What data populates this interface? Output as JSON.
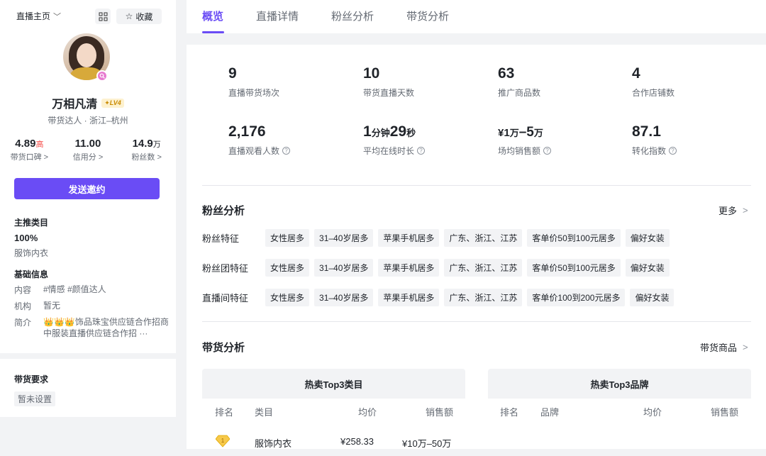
{
  "sidebar": {
    "home_label": "直播主页",
    "favorite_label": "收藏",
    "name": "万相凡清",
    "level": "LV4",
    "subtitle": "带货达人 · 浙江–杭州",
    "stats": [
      {
        "value": "4.89",
        "suffix": "高",
        "label": "带货口碑 >"
      },
      {
        "value": "11.00",
        "suffix": "",
        "label": "信用分 >"
      },
      {
        "value": "14.9",
        "suffix": "万",
        "label": "粉丝数 >"
      }
    ],
    "invite_label": "发送邀约",
    "main_category_title": "主推类目",
    "main_category_pct": "100%",
    "main_category_name": "服饰内衣",
    "basic_info_title": "基础信息",
    "info": [
      {
        "key": "内容",
        "value": "#情感  #颜值达人"
      },
      {
        "key": "机构",
        "value": "暂无"
      },
      {
        "key": "简介",
        "value_line1": "饰品珠宝供应链合作招商",
        "value_line2": "中服装直播供应链合作招 ···",
        "crowns": "👑👑👑"
      }
    ],
    "requirements_title": "带货要求",
    "requirements_value": "暂未设置"
  },
  "tabs": [
    "概览",
    "直播详情",
    "粉丝分析",
    "带货分析"
  ],
  "metrics": [
    {
      "num": "9",
      "label": "直播带货场次",
      "help": false
    },
    {
      "num": "10",
      "label": "带货直播天数",
      "help": false
    },
    {
      "num": "63",
      "label": "推广商品数",
      "help": false
    },
    {
      "num": "4",
      "label": "合作店铺数",
      "help": false
    },
    {
      "num": "2,176",
      "label": "直播观看人数",
      "help": true
    },
    {
      "num_parts": [
        "1",
        "分钟",
        "29",
        "秒"
      ],
      "label": "平均在线时长",
      "help": true
    },
    {
      "num_parts": [
        "¥1",
        "万",
        "–5",
        "万"
      ],
      "label": "场均销售额",
      "help": true
    },
    {
      "num": "87.1",
      "label": "转化指数",
      "help": true
    }
  ],
  "fan_analysis": {
    "title": "粉丝分析",
    "more": "更多",
    "rows": [
      {
        "label": "粉丝特征",
        "chips": [
          "女性居多",
          "31–40岁居多",
          "苹果手机居多",
          "广东、浙江、江苏",
          "客单价50到100元居多",
          "偏好女装"
        ]
      },
      {
        "label": "粉丝团特征",
        "chips": [
          "女性居多",
          "31–40岁居多",
          "苹果手机居多",
          "广东、浙江、江苏",
          "客单价50到100元居多",
          "偏好女装"
        ]
      },
      {
        "label": "直播间特征",
        "chips": [
          "女性居多",
          "31–40岁居多",
          "苹果手机居多",
          "广东、浙江、江苏",
          "客单价100到200元居多",
          "偏好女装"
        ]
      }
    ]
  },
  "sales_analysis": {
    "title": "带货分析",
    "more": "带货商品",
    "left_table": {
      "title": "热卖Top3类目",
      "columns": [
        "排名",
        "类目",
        "均价",
        "销售额"
      ],
      "rows": [
        {
          "name": "服饰内衣",
          "price": "¥258.33",
          "sales": "¥10万–50万"
        }
      ]
    },
    "right_table": {
      "title": "热卖Top3品牌",
      "columns": [
        "排名",
        "品牌",
        "均价",
        "销售额"
      ]
    }
  },
  "colors": {
    "accent": "#6a4cf5",
    "high": "#f54a45"
  }
}
